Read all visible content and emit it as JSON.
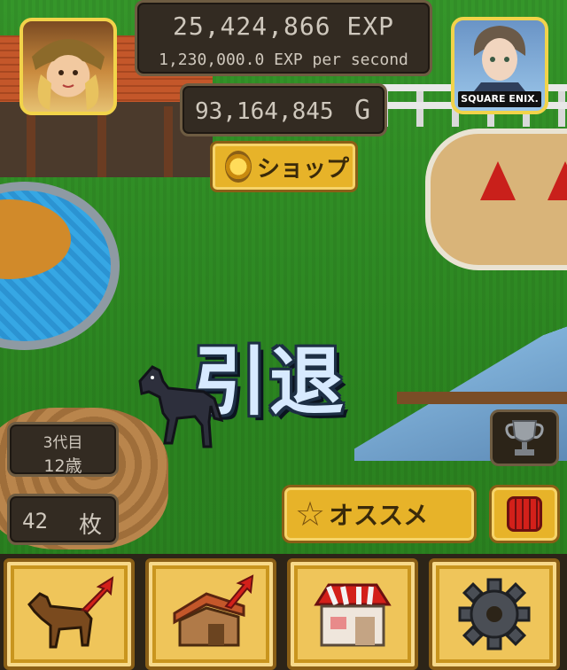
{
  "hud": {
    "exp_total": "25,424,866 EXP",
    "exp_rate": "1,230,000.0 EXP per second",
    "gold": "93,164,845",
    "gold_unit": "G"
  },
  "sponsor": {
    "publisher_label": "SQUARE ENIX."
  },
  "buttons": {
    "shop": "ショップ",
    "recommend": "オススメ"
  },
  "center": {
    "retire_label": "引退"
  },
  "horse_status": {
    "generation": "3代目",
    "age": "12歳"
  },
  "tickets": {
    "count": "42",
    "unit": "枚"
  },
  "bottom_nav": [
    {
      "name": "horse-upgrade",
      "icon": "horse-arrow-icon"
    },
    {
      "name": "stable-upgrade",
      "icon": "stable-arrow-icon"
    },
    {
      "name": "shop",
      "icon": "shop-awning-icon"
    },
    {
      "name": "settings",
      "icon": "gear-icon"
    }
  ],
  "colors": {
    "button_gold": "#e7b329",
    "panel_dark": "#332b22",
    "panel_text": "#cfc8bd",
    "bag_red": "#d3201a"
  }
}
